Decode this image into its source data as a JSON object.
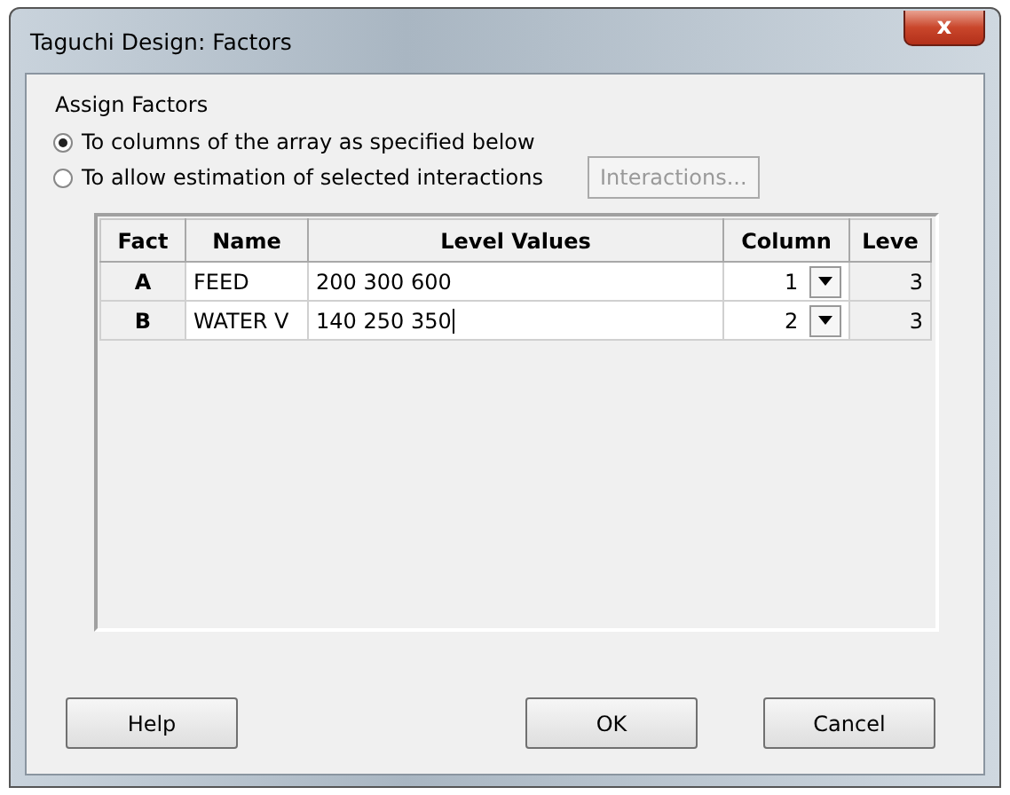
{
  "window": {
    "title": "Taguchi Design: Factors",
    "close": "x"
  },
  "group_label": "Assign Factors",
  "options": [
    {
      "label": "To columns of the array as specified below",
      "selected": true
    },
    {
      "label": "To allow estimation of selected interactions",
      "selected": false
    }
  ],
  "interactions_button": {
    "label": "Interactions...",
    "disabled": true
  },
  "table": {
    "columns": [
      "Fact",
      "Name",
      "Level Values",
      "Column",
      "Leve"
    ],
    "rows": [
      {
        "factor": "A",
        "name": "FEED",
        "level_values": "200 300 600",
        "column": "1",
        "levels": "3",
        "editing": false
      },
      {
        "factor": "B",
        "name": "WATER V",
        "level_values": "140 250 350",
        "column": "2",
        "levels": "3",
        "editing": true
      }
    ]
  },
  "buttons": [
    {
      "label": "Help",
      "kind": "left"
    },
    {
      "label": "OK",
      "kind": "right"
    },
    {
      "label": "Cancel",
      "kind": "right"
    }
  ]
}
